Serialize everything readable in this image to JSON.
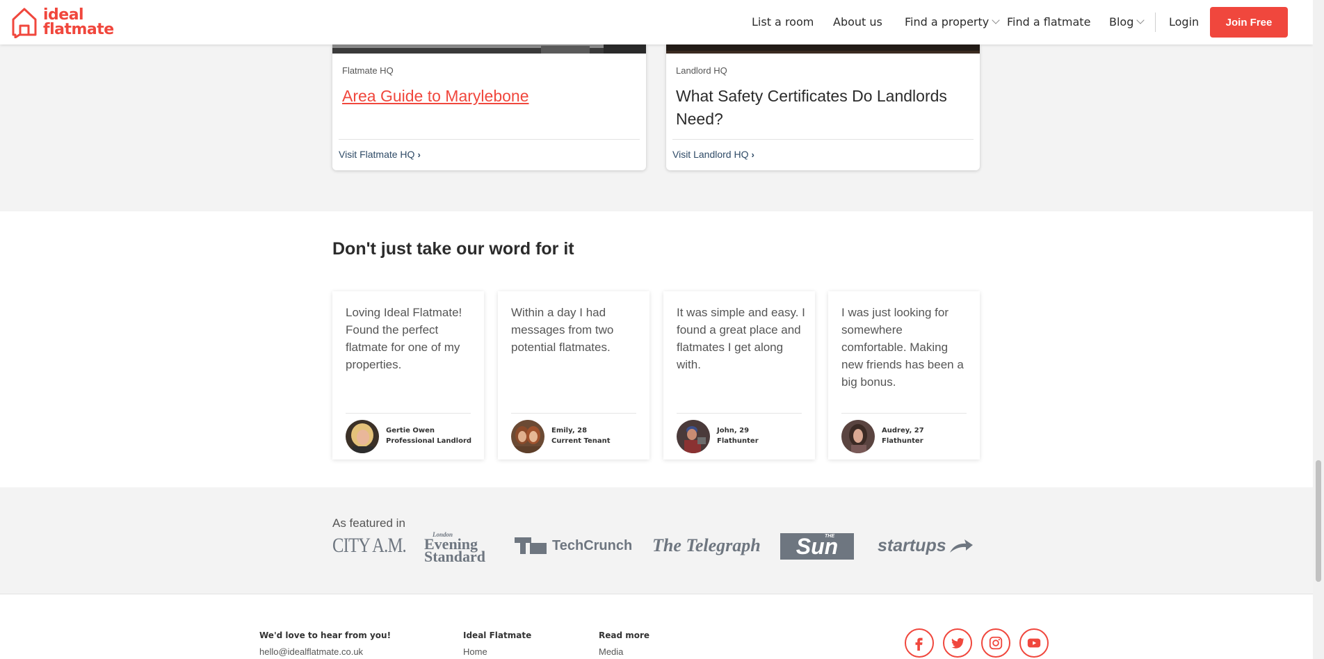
{
  "header": {
    "logo": {
      "line1": "ideal",
      "line2": "flatmate"
    },
    "nav": [
      {
        "label": "List a room"
      },
      {
        "label": "About us"
      },
      {
        "label": "Find a property"
      },
      {
        "label": "Find a flatmate"
      },
      {
        "label": "Blog"
      }
    ],
    "login": "Login",
    "join": "Join Free"
  },
  "blog_cards": [
    {
      "category": "Flatmate HQ",
      "title": "Area Guide to Marylebone",
      "footer": "Visit Flatmate HQ"
    },
    {
      "category": "Landlord HQ",
      "title": "What Safety Certificates Do Landlords Need?",
      "footer": "Visit Landlord HQ"
    }
  ],
  "testimonials": {
    "title": "Don't just take our word for it",
    "items": [
      {
        "quote": "Loving Ideal Flatmate! Found the perfect flatmate for one of my properties.",
        "name": "Gertie Owen",
        "role": "Professional Landlord"
      },
      {
        "quote": "Within a day I had messages from two potential flatmates.",
        "name": "Emily, 28",
        "role": "Current Tenant"
      },
      {
        "quote": "It was simple and easy. I found a great place and flatmates I get along with.",
        "name": "John, 29",
        "role": "Flathunter"
      },
      {
        "quote": "I was just looking for somewhere comfortable. Making new friends has been a big bonus.",
        "name": "Audrey, 27",
        "role": "Flathunter"
      }
    ]
  },
  "featured": {
    "label": "As featured in",
    "logos": {
      "city": "CITY A.M.",
      "es_london": "London",
      "es_line1": "Evening",
      "es_line2": "Standard",
      "techcrunch": "TechCrunch",
      "telegraph": "The Telegraph",
      "sun_the": "THE",
      "sun": "Sun",
      "startups": "startups"
    }
  },
  "footer": {
    "contact_title": "We'd love to hear from you!",
    "contact_email": "hello@idealflatmate.co.uk",
    "col2_title": "Ideal Flatmate",
    "col2_item": "Home",
    "col3_title": "Read more",
    "col3_item": "Media",
    "social": [
      "facebook-icon",
      "twitter-icon",
      "instagram-icon",
      "youtube-icon"
    ]
  },
  "colors": {
    "brand": "#f0473d",
    "link_dark": "#2e4a66",
    "logo_grey": "#6e7680"
  }
}
